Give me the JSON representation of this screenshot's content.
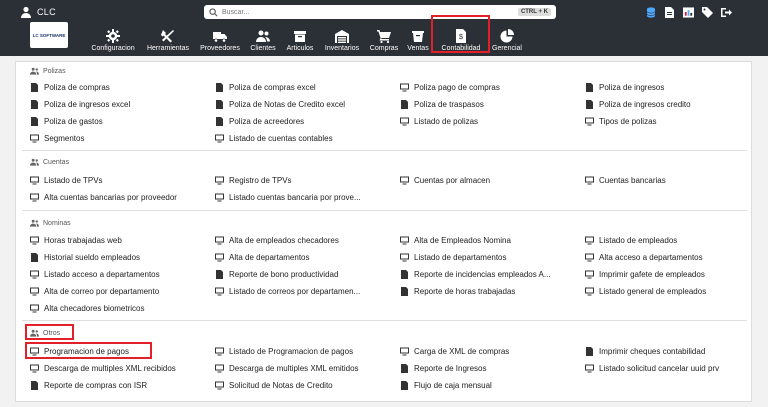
{
  "topbar": {
    "username": "CLC",
    "search_placeholder": "Buscar...",
    "search_shortcut": "CTRL + K",
    "logo_line1": "LC SOFTWARE",
    "logo_line2": "",
    "icons": [
      "database-icon",
      "file-icon",
      "report-icon",
      "tag-icon",
      "logout-icon"
    ]
  },
  "nav": {
    "items": [
      {
        "label": "Configuracion",
        "icon": "gear-icon"
      },
      {
        "label": "Herramientas",
        "icon": "tools-icon"
      },
      {
        "label": "Proveedores",
        "icon": "truck-icon"
      },
      {
        "label": "Clientes",
        "icon": "users-icon"
      },
      {
        "label": "Articulos",
        "icon": "box-icon"
      },
      {
        "label": "Inventarios",
        "icon": "warehouse-icon"
      },
      {
        "label": "Compras",
        "icon": "cart-icon"
      },
      {
        "label": "Ventas",
        "icon": "sales-icon"
      },
      {
        "label": "Contabilidad",
        "icon": "accounting-icon"
      },
      {
        "label": "Gerencial",
        "icon": "pie-chart-icon"
      }
    ],
    "active": "Contabilidad"
  },
  "sections": {
    "polizas": {
      "title": "Polizas",
      "items": [
        "Poliza de compras",
        "Poliza de compras excel",
        "Poliza pago de compras",
        "Poliza de ingresos",
        "Poliza de ingresos excel",
        "Poliza de Notas de Credito excel",
        "Poliza de traspasos",
        "Poliza de ingresos credito",
        "Poliza de gastos",
        "Poliza de acreedores",
        "Listado de polizas",
        "Tipos de polizas",
        "Segmentos",
        "Listado de cuentas contables"
      ]
    },
    "cuentas": {
      "title": "Cuentas",
      "items": [
        "Listado de TPVs",
        "Registro de TPVs",
        "Cuentas por almacen",
        "Cuentas bancarias",
        "Alta cuentas bancarias por proveedor",
        "Listado cuentas bancaria por prove..."
      ]
    },
    "nominas": {
      "title": "Nominas",
      "items": [
        "Horas trabajadas web",
        "Alta de empleados checadores",
        "Alta de Empleados Nomina",
        "Listado de empleados",
        "Historial sueldo empleados",
        "Alta de departamentos",
        "Listado de departamentos",
        "Alta acceso a departamentos",
        "Listado acceso a departamentos",
        "Reporte de bono productividad",
        "Reporte de incidencias empleados A...",
        "Imprimir gafete de empleados",
        "Alta de correo por departamento",
        "Listado de correos por departamen...",
        "Reporte de horas trabajadas",
        "Listado general de empleados",
        "Alta checadores biometricos"
      ]
    },
    "otros": {
      "title": "Otros",
      "items": [
        "Programacion de pagos",
        "Listado de Programacion de pagos",
        "Carga de XML de compras",
        "Imprimir cheques contabilidad",
        "Descarga de multiples XML recibidos",
        "Descarga de multiples XML emitidos",
        "Reporte de Ingresos",
        "Listado solicitud cancelar uuid prv",
        "Reporte de compras con ISR",
        "Solicitud de Notas de Credito",
        "Flujo de caja mensual"
      ]
    }
  },
  "colors": {
    "navbar": "#2b2f36",
    "highlight": "#e3202a",
    "text": "#222222"
  }
}
